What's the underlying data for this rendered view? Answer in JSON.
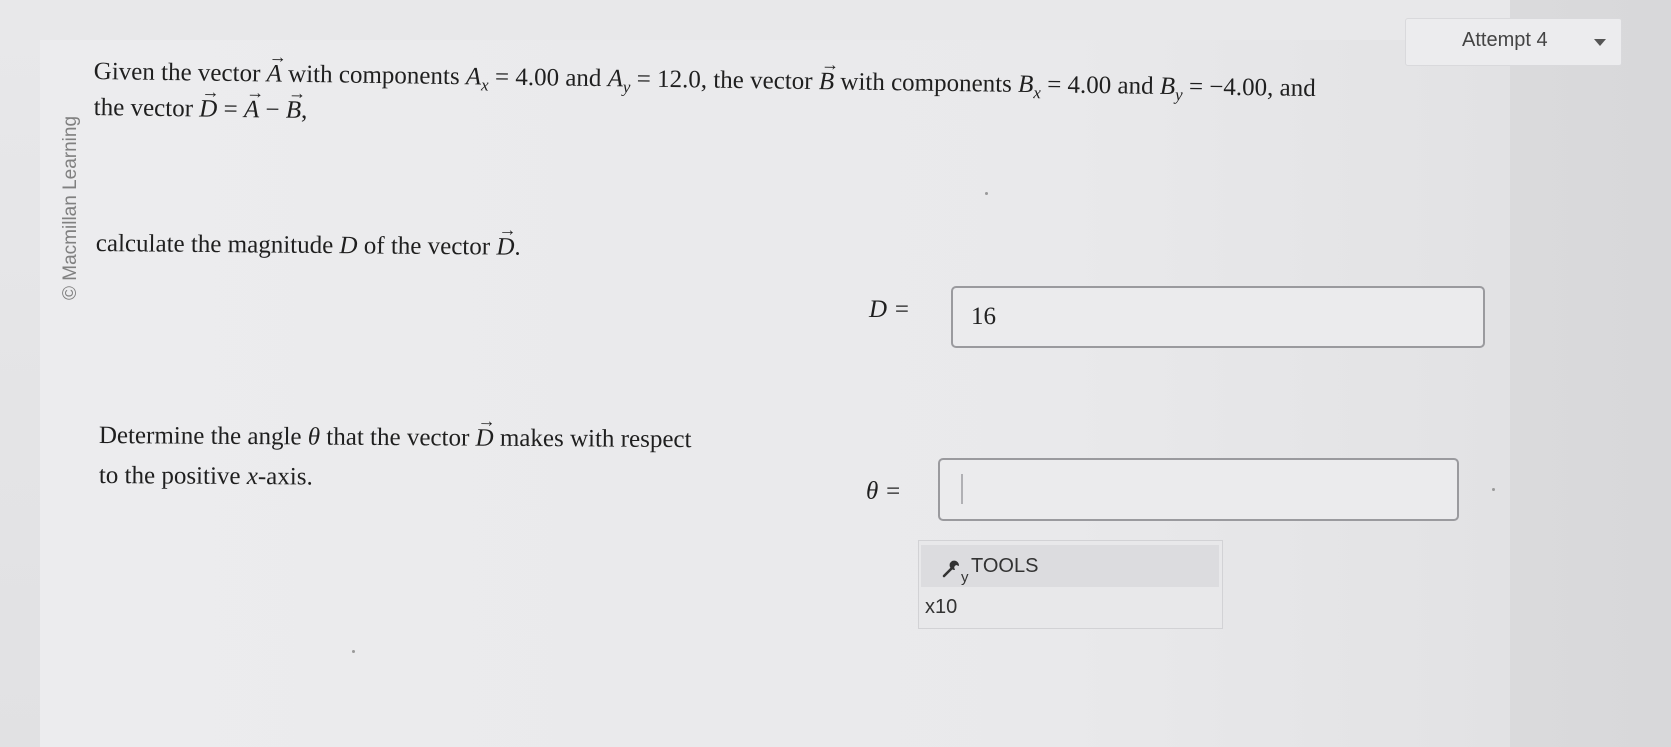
{
  "header": {
    "attempt_label": "Attempt 4",
    "attempt_caret_icon": "caret-down-icon"
  },
  "sidebar": {
    "copyright": "© Macmillan Learning"
  },
  "problem": {
    "line1_a": "Given the vector ",
    "vecA": "A",
    "line1_b": " with components ",
    "Ax": "A",
    "Ax_sub": "x",
    "line1_c": " = 4.00 and ",
    "Ay": "A",
    "Ay_sub": "y",
    "line1_d": " = 12.0, the vector ",
    "vecB": "B",
    "line1_e": " with components ",
    "Bx": "B",
    "Bx_sub": "x",
    "line1_f": " = 4.00 and ",
    "By": "B",
    "By_sub": "y",
    "line1_g": " = −4.00, and",
    "line2_a": "the vector ",
    "vecD": "D",
    "line2_b": " = ",
    "vecA2": "A",
    "line2_c": " − ",
    "vecB2": "B",
    "line2_d": ",",
    "line3_a": "calculate the magnitude ",
    "D": "D",
    "line3_b": " of the vector ",
    "vecD2": "D",
    "line3_c": ".",
    "line4_a": "Determine the angle ",
    "theta": "θ",
    "line4_b": " that the vector ",
    "vecD3": "D",
    "line4_c": " makes with respect",
    "line5_a": "to the positive ",
    "x": "x",
    "line5_b": "-axis."
  },
  "answers": {
    "d_label": "D =",
    "d_value": "16",
    "theta_label": "θ =",
    "theta_value": ""
  },
  "tools": {
    "icon": "wrench-icon",
    "sub_y": "y",
    "label": "TOOLS",
    "x10_label": "x10"
  }
}
